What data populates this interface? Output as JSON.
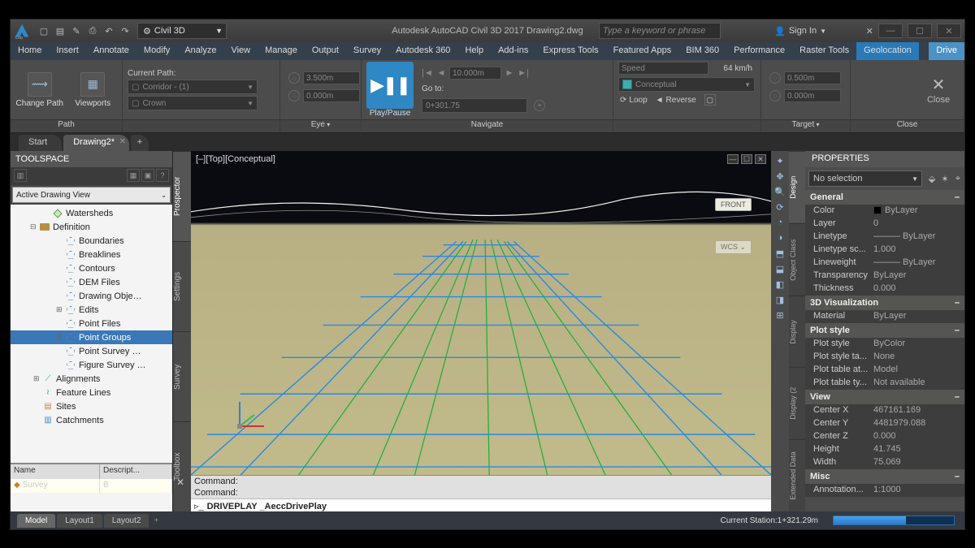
{
  "titlebar": {
    "workspace": "Civil 3D",
    "title": "Autodesk AutoCAD Civil 3D 2017   Drawing2.dwg",
    "search_placeholder": "Type a keyword or phrase",
    "signin": "Sign In"
  },
  "menubar": [
    "Home",
    "Insert",
    "Annotate",
    "Modify",
    "Analyze",
    "View",
    "Manage",
    "Output",
    "Survey",
    "Autodesk 360",
    "Help",
    "Add-ins",
    "Express Tools",
    "Featured Apps",
    "BIM 360",
    "Performance",
    "Raster Tools",
    "Geolocation",
    "Drive"
  ],
  "active_menu_index": 18,
  "ribbon": {
    "change_path": "Change Path",
    "viewports": "Viewports",
    "path_panel": "Path",
    "current_path_label": "Current Path:",
    "path_top": "Corridor - (1)",
    "path_bottom": "Crown",
    "eye_panel": "Eye",
    "eye_top": "3.500m",
    "eye_bottom": "0.000m",
    "playpause": "Play/Pause",
    "navigate_panel": "Navigate",
    "step_value": "10.000m",
    "goto_label": "Go to:",
    "goto_value": "0+301.75",
    "speed_label": "Speed",
    "speed_value": "64 km/h",
    "visual_style": "Conceptual",
    "loop": "Loop",
    "reverse": "Reverse",
    "target_panel": "Target",
    "target_top": "0.500m",
    "target_bottom": "0.000m",
    "close": "Close"
  },
  "doctabs": {
    "start": "Start",
    "current": "Drawing2*"
  },
  "toolspace": {
    "title": "TOOLSPACE",
    "view_dd": "Active Drawing View",
    "vtabs": [
      "Prospector",
      "Settings",
      "Survey",
      "Toolbox"
    ],
    "tree": [
      {
        "lvl": "indent1",
        "exp": "",
        "ico": "shield",
        "label": "Watersheds"
      },
      {
        "lvl": "indent0",
        "exp": "⊟",
        "ico": "folder",
        "label": "Definition"
      },
      {
        "lvl": "indent2",
        "exp": "",
        "ico": "poly",
        "label": "Boundaries"
      },
      {
        "lvl": "indent2",
        "exp": "",
        "ico": "poly",
        "label": "Breaklines"
      },
      {
        "lvl": "indent2",
        "exp": "",
        "ico": "poly",
        "label": "Contours"
      },
      {
        "lvl": "indent2",
        "exp": "",
        "ico": "poly",
        "label": "DEM Files"
      },
      {
        "lvl": "indent2",
        "exp": "",
        "ico": "poly",
        "label": "Drawing Obje…"
      },
      {
        "lvl": "indent2",
        "exp": "⊞",
        "ico": "poly",
        "label": "Edits"
      },
      {
        "lvl": "indent2",
        "exp": "",
        "ico": "poly",
        "label": "Point Files"
      },
      {
        "lvl": "indent2",
        "exp": "⊞",
        "ico": "poly",
        "label": "Point Groups",
        "sel": true
      },
      {
        "lvl": "indent2",
        "exp": "",
        "ico": "poly",
        "label": "Point Survey …"
      },
      {
        "lvl": "indent2",
        "exp": "",
        "ico": "poly",
        "label": "Figure Survey …"
      },
      {
        "lvl": "indentA",
        "exp": "⊞",
        "ico": "align",
        "label": "Alignments"
      },
      {
        "lvl": "indentA",
        "exp": "",
        "ico": "feat",
        "label": "Feature Lines"
      },
      {
        "lvl": "indentA",
        "exp": "",
        "ico": "site",
        "label": "Sites"
      },
      {
        "lvl": "indentA",
        "exp": "",
        "ico": "catch",
        "label": "Catchments"
      }
    ],
    "grid": {
      "col1": "Name",
      "col2": "Descript...",
      "row1": "Survey",
      "row1b": "B"
    }
  },
  "viewport": {
    "label": "[–][Top][Conceptual]",
    "front": "FRONT",
    "wcs": "WCS"
  },
  "cmd": {
    "hist1": "Command:",
    "hist2": "Command:",
    "prompt": "DRIVEPLAY _AeccDrivePlay"
  },
  "rtabs": [
    "Design",
    "Object Class",
    "Display",
    "Display (2",
    "Extended Data"
  ],
  "props": {
    "title": "PROPERTIES",
    "selection": "No selection",
    "groups": [
      {
        "name": "General",
        "rows": [
          {
            "k": "Color",
            "v": "ByLayer",
            "swatch": true
          },
          {
            "k": "Layer",
            "v": "0"
          },
          {
            "k": "Linetype",
            "v": "———  ByLayer"
          },
          {
            "k": "Linetype sc...",
            "v": "1.000"
          },
          {
            "k": "Lineweight",
            "v": "———  ByLayer"
          },
          {
            "k": "Transparency",
            "v": "ByLayer"
          },
          {
            "k": "Thickness",
            "v": "0.000"
          }
        ]
      },
      {
        "name": "3D Visualization",
        "rows": [
          {
            "k": "Material",
            "v": "ByLayer"
          }
        ]
      },
      {
        "name": "Plot style",
        "rows": [
          {
            "k": "Plot style",
            "v": "ByColor"
          },
          {
            "k": "Plot style ta...",
            "v": "None"
          },
          {
            "k": "Plot table at...",
            "v": "Model"
          },
          {
            "k": "Plot table ty...",
            "v": "Not available"
          }
        ]
      },
      {
        "name": "View",
        "rows": [
          {
            "k": "Center X",
            "v": "467161.169"
          },
          {
            "k": "Center Y",
            "v": "4481979.088"
          },
          {
            "k": "Center Z",
            "v": "0.000"
          },
          {
            "k": "Height",
            "v": "41.745"
          },
          {
            "k": "Width",
            "v": "75.069"
          }
        ]
      },
      {
        "name": "Misc",
        "rows": [
          {
            "k": "Annotation...",
            "v": "1:1000"
          }
        ]
      }
    ]
  },
  "status": {
    "tabs": [
      "Model",
      "Layout1",
      "Layout2"
    ],
    "station": "Current Station:1+321.29m"
  }
}
